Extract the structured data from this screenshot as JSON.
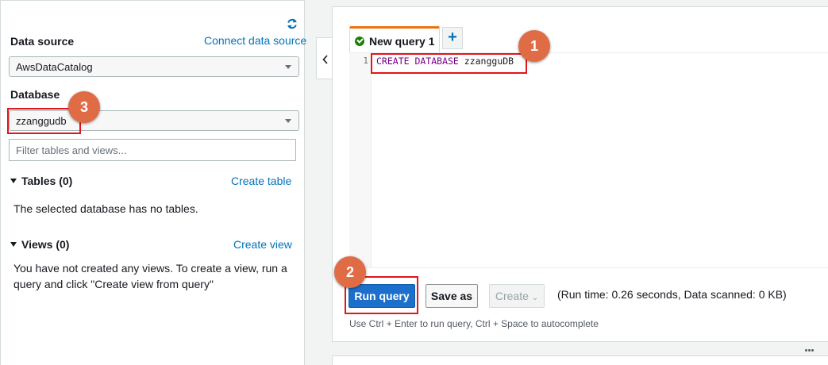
{
  "left_panel": {
    "data_source_label": "Data source",
    "connect_link": "Connect data source",
    "data_source_value": "AwsDataCatalog",
    "database_label": "Database",
    "database_value": "zzanggudb",
    "filter_placeholder": "Filter tables and views...",
    "tables_header": "Tables (0)",
    "create_table_link": "Create table",
    "tables_empty": "The selected database has no tables.",
    "views_header": "Views (0)",
    "create_view_link": "Create view",
    "views_empty_line1": "You have not created any views. To create a view, run a",
    "views_empty_line2": "query and click \"Create view from query\""
  },
  "editor": {
    "tab_label": "New query 1",
    "add_tab": "+",
    "line_number": "1",
    "code_keyword": "CREATE DATABASE",
    "code_ident": " zzangguDB"
  },
  "actions": {
    "run_query": "Run query",
    "save_as": "Save as",
    "create": "Create",
    "create_chevron": "⌄",
    "run_status": "(Run time: 0.26 seconds, Data scanned: 0 KB)",
    "hint": "Use Ctrl + Enter to run query, Ctrl + Space to autocomplete"
  },
  "annotations": {
    "marker_1": "1",
    "marker_2": "2",
    "marker_3": "3"
  },
  "colors": {
    "accent_link": "#0073bb",
    "primary_button": "#1d6fcc",
    "tab_accent": "#ec7211",
    "annotation_marker": "#e06c46",
    "highlight_box": "#e3141a",
    "keyword": "#770088"
  },
  "icons": {
    "refresh": "refresh-icon",
    "collapse": "chevron-left-icon",
    "success": "check-circle-icon",
    "more": "more-icon"
  }
}
